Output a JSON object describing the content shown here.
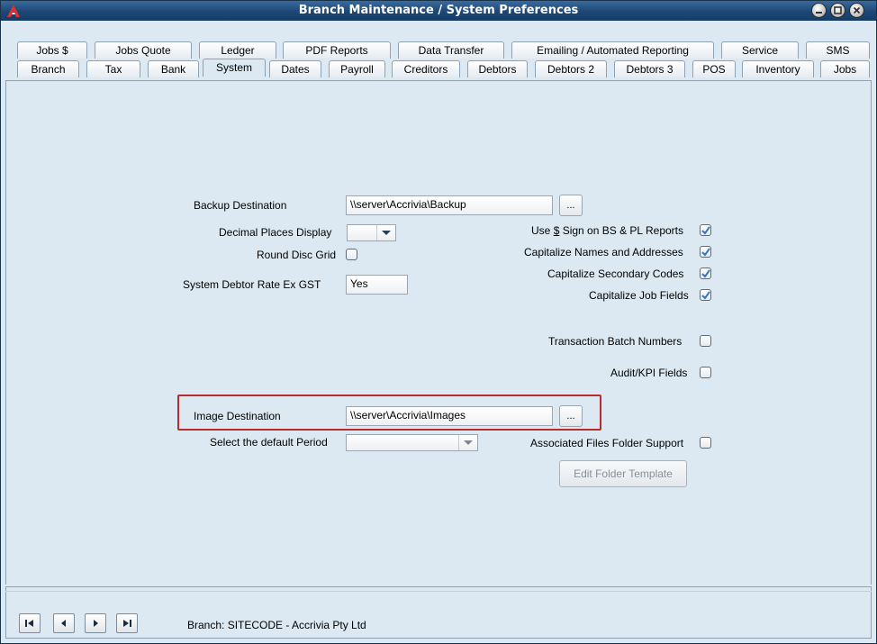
{
  "window": {
    "title": "Branch Maintenance / System Preferences"
  },
  "tabs_row1": [
    "Jobs $",
    "Jobs Quote",
    "Ledger",
    "PDF Reports",
    "Data Transfer",
    "Emailing / Automated Reporting",
    "Service",
    "SMS"
  ],
  "tabs_row2": [
    "Branch",
    "Tax",
    "Bank",
    "System",
    "Dates",
    "Payroll",
    "Creditors",
    "Debtors",
    "Debtors 2",
    "Debtors 3",
    "POS",
    "Inventory",
    "Jobs"
  ],
  "active_tab": "System",
  "system": {
    "backup_destination": {
      "label": "Backup Destination",
      "value": "\\\\server\\Accrivia\\Backup",
      "browse": "..."
    },
    "decimal_places": {
      "label": "Decimal Places Display",
      "value": ""
    },
    "round_disc_grid": {
      "label": "Round Disc Grid",
      "checked": false
    },
    "debtor_rate": {
      "label": "System Debtor Rate Ex GST",
      "value": "Yes"
    },
    "image_destination": {
      "label": "Image Destination",
      "value": "\\\\server\\Accrivia\\Images",
      "browse": "..."
    },
    "default_period": {
      "label": "Select the default Period",
      "value": ""
    },
    "use_dollar_sign": {
      "label": "Use $ Sign on BS & PL Reports",
      "checked": true
    },
    "capitalize_names": {
      "label": "Capitalize Names and Addresses",
      "checked": true
    },
    "capitalize_secondary": {
      "label": "Capitalize Secondary Codes",
      "checked": true
    },
    "capitalize_job": {
      "label": "Capitalize Job Fields",
      "checked": true
    },
    "transaction_batch": {
      "label": "Transaction Batch Numbers",
      "checked": false
    },
    "audit_kpi": {
      "label": "Audit/KPI Fields",
      "checked": false
    },
    "associated_files": {
      "label": "Associated Files Folder Support",
      "checked": false
    },
    "edit_folder_template": "Edit Folder Template"
  },
  "status": {
    "branch": "Branch:  SITECODE - Accrivia Pty Ltd"
  },
  "colors": {
    "titlebar": "#1c4775",
    "panel": "#dce9f2",
    "highlight": "#b62d2d"
  }
}
